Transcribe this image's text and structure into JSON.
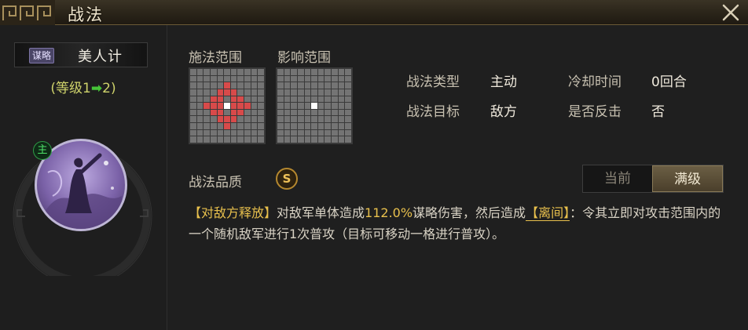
{
  "window": {
    "title": "战法"
  },
  "skill": {
    "type_badge": "谋略",
    "name": "美人计",
    "level_prefix": "(等级1",
    "level_arrow": "➡",
    "level_suffix": "2)",
    "role_badge": "主",
    "portrait_icon": "dancer-portrait"
  },
  "ranges": {
    "cast_label": "施法范围",
    "affect_label": "影响范围",
    "cast_grid": {
      "size": 11,
      "center": [
        5,
        5
      ],
      "red_cells": [
        [
          2,
          5
        ],
        [
          3,
          4
        ],
        [
          3,
          5
        ],
        [
          3,
          6
        ],
        [
          4,
          3
        ],
        [
          4,
          4
        ],
        [
          4,
          6
        ],
        [
          4,
          7
        ],
        [
          5,
          2
        ],
        [
          5,
          3
        ],
        [
          5,
          4
        ],
        [
          5,
          6
        ],
        [
          5,
          7
        ],
        [
          5,
          8
        ],
        [
          6,
          3
        ],
        [
          6,
          4
        ],
        [
          6,
          6
        ],
        [
          6,
          7
        ],
        [
          7,
          4
        ],
        [
          7,
          5
        ],
        [
          7,
          6
        ],
        [
          8,
          5
        ]
      ]
    },
    "affect_grid": {
      "size": 11,
      "center": [
        5,
        5
      ],
      "red_cells": []
    }
  },
  "info": {
    "type_label": "战法类型",
    "type_value": "主动",
    "cooldown_label": "冷却时间",
    "cooldown_value": "0回合",
    "target_label": "战法目标",
    "target_value": "敌方",
    "counter_label": "是否反击",
    "counter_value": "否"
  },
  "quality": {
    "label": "战法品质",
    "grade": "S"
  },
  "toggle": {
    "current": "当前",
    "max": "满级",
    "selected": "max"
  },
  "description": {
    "tag": "【对敌方释放】",
    "part1": "对敌军单体造成",
    "value": "112.0%",
    "part2": "谋略伤害，然后造成",
    "status": "【离间】",
    "part3": "：令其立即对攻击范围内的一个随机敌军进行1次普攻（目标可移动一格进行普攻）。"
  },
  "colors": {
    "highlight": "#e8c04d",
    "range_red": "#d84a4a",
    "level_arrow": "#46c438"
  }
}
